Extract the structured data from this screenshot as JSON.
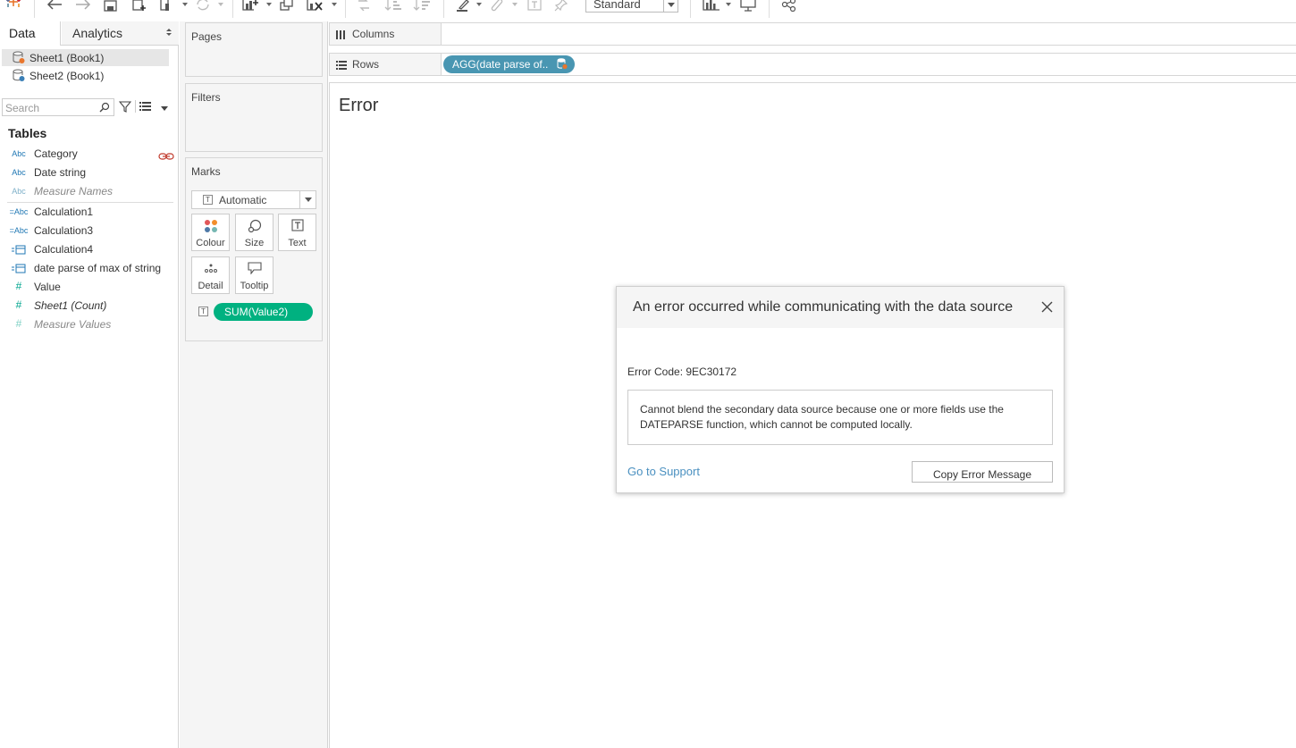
{
  "toolbar": {
    "fit_value": "Standard",
    "icons": [
      "tableau-logo-icon",
      "undo-icon",
      "redo-icon",
      "save-icon",
      "new-datasource-icon",
      "new-worksheet-icon",
      "refresh-icon",
      "new-sheet-icon",
      "duplicate-icon",
      "clear-icon",
      "swap-icon",
      "sort-asc-icon",
      "sort-desc-icon",
      "highlight-icon",
      "group-icon",
      "label-icon",
      "pin-icon",
      "show-me-icon",
      "presentation-icon",
      "share-icon"
    ]
  },
  "data_pane": {
    "tabs": {
      "data": "Data",
      "analytics": "Analytics"
    },
    "datasources": [
      {
        "label": "Sheet1 (Book1)",
        "selected": true,
        "status_color": "#e8762d"
      },
      {
        "label": "Sheet2 (Book1)",
        "selected": false,
        "status_color": "#3b7fb6"
      }
    ],
    "search_placeholder": "Search",
    "tables_title": "Tables",
    "fields": [
      {
        "type": "Abc",
        "label": "Category",
        "kind": "dim",
        "linked": true
      },
      {
        "type": "Abc",
        "label": "Date string",
        "kind": "dim"
      },
      {
        "type": "Abc",
        "label": "Measure Names",
        "kind": "dim",
        "italic": true,
        "gray": true
      },
      {
        "type": "=Abc",
        "label": "Calculation1",
        "kind": "dim"
      },
      {
        "type": "=Abc",
        "label": "Calculation3",
        "kind": "dim"
      },
      {
        "type": "=cal",
        "label": "Calculation4",
        "kind": "dim"
      },
      {
        "type": "=cal",
        "label": "date parse of max of string",
        "kind": "dim"
      },
      {
        "type": "#",
        "label": "Value",
        "kind": "meas"
      },
      {
        "type": "#",
        "label": "Sheet1 (Count)",
        "kind": "meas",
        "italic": true
      },
      {
        "type": "#",
        "label": "Measure Values",
        "kind": "meas",
        "italic": true,
        "gray": true
      }
    ]
  },
  "cards": {
    "pages": "Pages",
    "filters": "Filters",
    "marks": "Marks",
    "mark_type": "Automatic",
    "mark_buttons": [
      "Colour",
      "Size",
      "Text",
      "Detail",
      "Tooltip"
    ],
    "marks_pill": "SUM(Value2)"
  },
  "shelves": {
    "columns_label": "Columns",
    "rows_label": "Rows",
    "rows_pill": "AGG(date parse of.."
  },
  "view": {
    "sheet_title": "Error"
  },
  "error_dialog": {
    "title": "An error occurred while communicating with the data source",
    "code": "Error Code: 9EC30172",
    "message": "Cannot blend the secondary data source because one or more fields use the DATEPARSE function, which cannot be computed locally.",
    "support_link": "Go to Support",
    "copy_button": "Copy Error Message"
  },
  "colors": {
    "measure_pill": "#00b180",
    "dimension_pill": "#4996b2",
    "link": "#4a90c0",
    "linked_field": "#c0392b"
  }
}
